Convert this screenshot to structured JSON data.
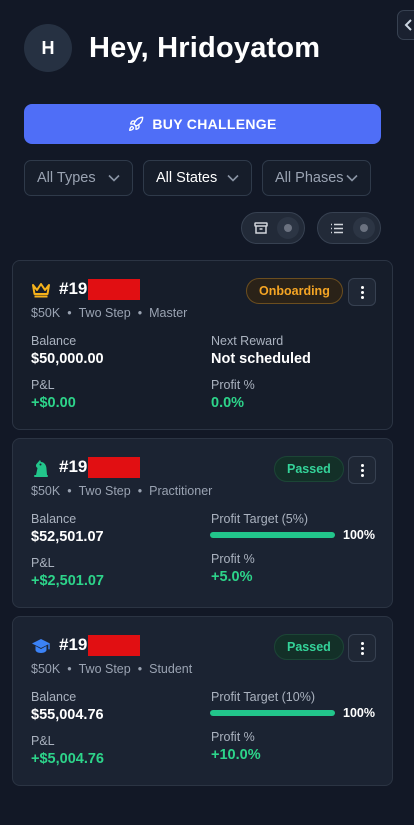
{
  "greeting": {
    "avatar_initial": "H",
    "text": "Hey, Hridoyatom"
  },
  "buy_button": {
    "label": "BUY CHALLENGE"
  },
  "filters": [
    {
      "label": "All Types"
    },
    {
      "label": "All States"
    },
    {
      "label": "All Phases"
    }
  ],
  "accounts": [
    {
      "account_prefix": "#19",
      "size": "$50K",
      "steps": "Two Step",
      "tier": "Master",
      "status": "Onboarding",
      "left_top_label": "Balance",
      "left_top_value": "$50,000.00",
      "left_bottom_label": "P&L",
      "left_bottom_value": "+$0.00",
      "right_top_label": "Next Reward",
      "right_top_value": "Not scheduled",
      "right_bottom_label": "Profit %",
      "right_bottom_value": "0.0%"
    },
    {
      "account_prefix": "#19",
      "size": "$50K",
      "steps": "Two Step",
      "tier": "Practitioner",
      "status": "Passed",
      "left_top_label": "Balance",
      "left_top_value": "$52,501.07",
      "left_bottom_label": "P&L",
      "left_bottom_value": "+$2,501.07",
      "right_top_label": "Profit Target (5%)",
      "progress_text": "100%",
      "progress_fraction": 1.0,
      "right_bottom_label": "Profit %",
      "right_bottom_value": "+5.0%"
    },
    {
      "account_prefix": "#19",
      "size": "$50K",
      "steps": "Two Step",
      "tier": "Student",
      "status": "Passed",
      "left_top_label": "Balance",
      "left_top_value": "$55,004.76",
      "left_bottom_label": "P&L",
      "left_bottom_value": "+$5,004.76",
      "right_top_label": "Profit Target (10%)",
      "progress_text": "100%",
      "progress_fraction": 1.0,
      "right_bottom_label": "Profit %",
      "right_bottom_value": "+10.0%"
    }
  ],
  "colors": {
    "accent": "#4f6ef7",
    "positive": "#2dd48a",
    "warning": "#f5a524",
    "redaction": "#e10f12"
  },
  "icons": {
    "crown": "crown-icon",
    "knight": "chess-knight-icon",
    "cap": "graduation-cap-icon",
    "rocket": "rocket-icon",
    "archive": "archive-icon",
    "list": "list-icon"
  }
}
